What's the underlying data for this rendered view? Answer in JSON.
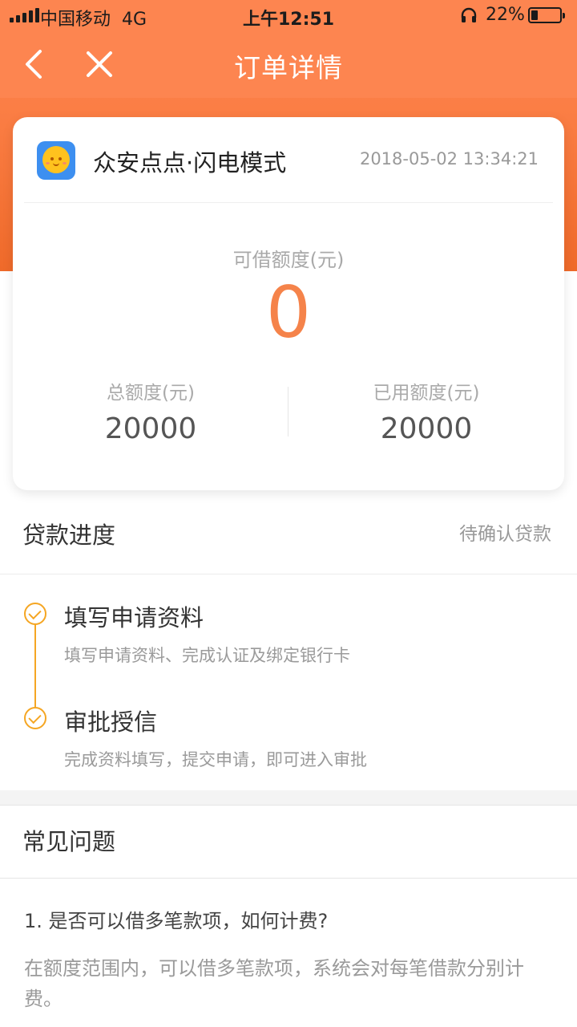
{
  "status_bar": {
    "carrier": "中国移动",
    "network": "4G",
    "time": "上午12:51",
    "battery": "22%"
  },
  "nav": {
    "title": "订单详情"
  },
  "card": {
    "app_name": "众安点点·闪电模式",
    "timestamp": "2018-05-02 13:34:21",
    "available_label": "可借额度(元)",
    "available_value": "0",
    "total_label": "总额度(元)",
    "total_value": "20000",
    "used_label": "已用额度(元)",
    "used_value": "20000"
  },
  "progress": {
    "title": "贷款进度",
    "status": "待确认贷款",
    "steps": [
      {
        "title": "填写申请资料",
        "desc": "填写申请资料、完成认证及绑定银行卡"
      },
      {
        "title": "审批授信",
        "desc": "完成资料填写，提交申请，即可进入审批"
      }
    ]
  },
  "faq": {
    "title": "常见问题",
    "question": "1. 是否可以借多笔款项，如何计费?",
    "answer": "在额度范围内，可以借多笔款项，系统会对每笔借款分别计费。"
  },
  "colors": {
    "header_orange": "#fd8550",
    "accent_orange": "#f5834a",
    "step_yellow": "#f5a623"
  }
}
